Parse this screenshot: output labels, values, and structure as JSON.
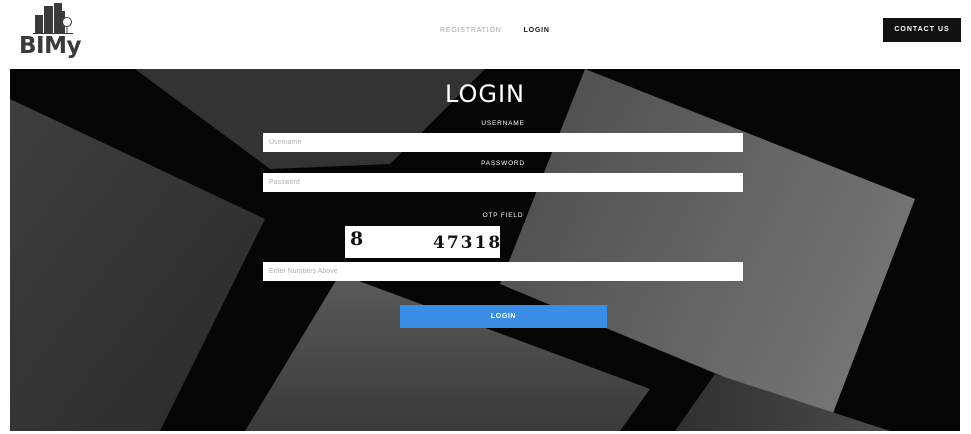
{
  "brand": {
    "logo_text": "BIMy"
  },
  "nav": {
    "items": [
      {
        "label": "REGISTRATION"
      },
      {
        "label": "LOGIN"
      }
    ]
  },
  "header": {
    "contact_label": "CONTACT US"
  },
  "form": {
    "title": "LOGIN",
    "username_label": "USERNAME",
    "username_placeholder": "Username",
    "password_label": "PASSWORD",
    "password_placeholder": "Password",
    "otp_label": "OTP FIELD",
    "captcha_part1": "8",
    "captcha_part2": "47318",
    "otp_placeholder": "Enter Numbers Above",
    "submit_label": "LOGIN"
  },
  "colors": {
    "accent": "#3a8ee6",
    "hero_bg": "#050505",
    "contact_bg": "#111111"
  }
}
